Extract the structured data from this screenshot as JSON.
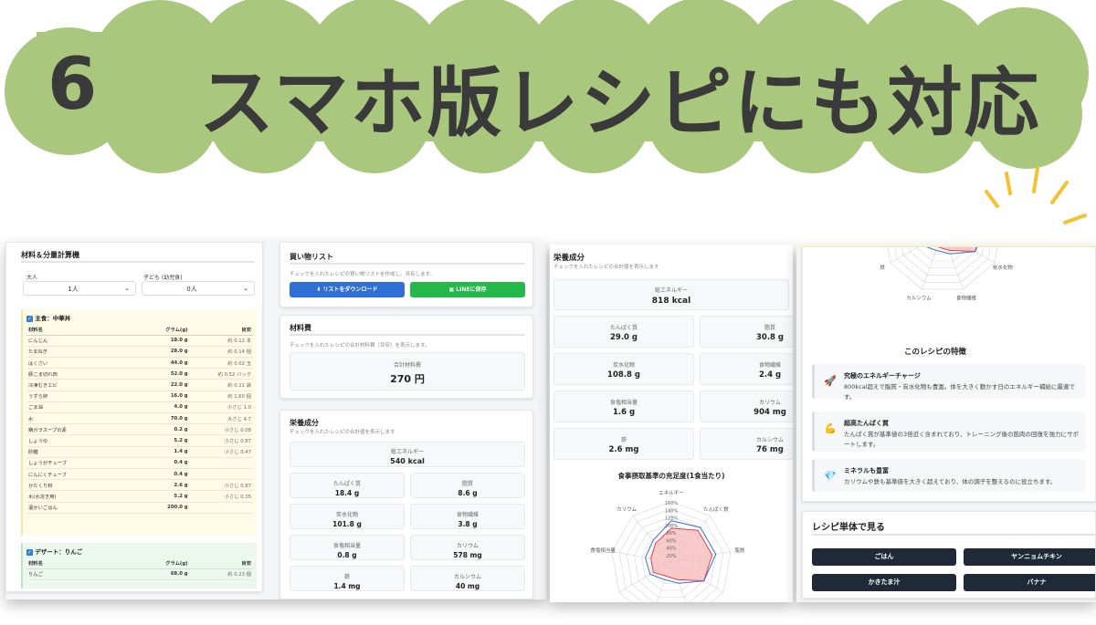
{
  "banner": {
    "number": "6",
    "title": "スマホ版レシピにも対応"
  },
  "calculator": {
    "title": "材料＆分量計算機",
    "adults_label": "大人",
    "adults_value": "1人",
    "kids_label": "子ども (幼児食)",
    "kids_value": "0人",
    "main_section": "主食：中華丼",
    "headers": [
      "材料名",
      "グラム(g)",
      "目安"
    ],
    "main_rows": [
      [
        "にんじん",
        "18.0 g",
        "約 0.12 本"
      ],
      [
        "たまねぎ",
        "28.0 g",
        "約 0.14 個"
      ],
      [
        "はくさい",
        "44.0 g",
        "約 0.02 玉"
      ],
      [
        "豚こま切れ肉",
        "52.0 g",
        "約 0.52 パック"
      ],
      [
        "冷凍むきエビ",
        "22.0 g",
        "約 0.11 袋"
      ],
      [
        "うずら卵",
        "16.0 g",
        "約 1.60 個"
      ],
      [
        "ごま油",
        "4.0 g",
        "小さじ 1.0"
      ],
      [
        "水",
        "70.0 g",
        "大さじ 4.7"
      ],
      [
        "鶏ガラスープの素",
        "0.2 g",
        "小さじ 0.08"
      ],
      [
        "しょうゆ",
        "5.2 g",
        "小さじ 0.87"
      ],
      [
        "砂糖",
        "1.4 g",
        "小さじ 0.47"
      ],
      [
        "しょうがチューブ",
        "0.4 g",
        ""
      ],
      [
        "にんにくチューブ",
        "0.4 g",
        ""
      ],
      [
        "かたくり粉",
        "2.6 g",
        "小さじ 0.87"
      ],
      [
        "水(水溶き用)",
        "5.2 g",
        "小さじ 0.35"
      ],
      [
        "温かいごはん",
        "200.0 g",
        ""
      ]
    ],
    "dessert_section": "デザート：りんご",
    "dessert_rows": [
      [
        "りんご",
        "68.0 g",
        "約 0.23 個"
      ]
    ]
  },
  "shopping": {
    "title": "買い物リスト",
    "desc": "チェックを入れたレシピの買い物リストを作成し、共有します。",
    "download_label": "リストをダウンロード",
    "line_label": "LINEに保存"
  },
  "cost": {
    "title": "材料費",
    "desc": "チェックを入れたレシピの合計材料費（目安）を表示します。",
    "total_label": "合計材料費",
    "total_value": "270 円"
  },
  "nutrition_small": {
    "title": "栄養成分",
    "desc": "チェックを入れたレシピの合計値を表示します",
    "energy_label": "総エネルギー",
    "energy_value": "540 kcal",
    "items": [
      [
        "たんぱく質",
        "18.4 g"
      ],
      [
        "脂質",
        "8.6 g"
      ],
      [
        "炭水化物",
        "101.8 g"
      ],
      [
        "食物繊維",
        "3.8 g"
      ],
      [
        "食塩相当量",
        "0.8 g"
      ],
      [
        "カリウム",
        "578 mg"
      ],
      [
        "鉄",
        "1.4 mg"
      ],
      [
        "カルシウム",
        "40 mg"
      ]
    ]
  },
  "nutrition_large": {
    "title": "栄養成分",
    "desc": "チェックを入れたレシピの合計値を表示します",
    "energy_label": "総エネルギー",
    "energy_value": "818 kcal",
    "items": [
      [
        "たんぱく質",
        "29.0 g"
      ],
      [
        "脂質",
        "30.8 g"
      ],
      [
        "炭水化物",
        "108.8 g"
      ],
      [
        "食物繊維",
        "2.4 g"
      ],
      [
        "食塩相当量",
        "1.6 g"
      ],
      [
        "カリウム",
        "904 mg"
      ],
      [
        "鉄",
        "2.6 mg"
      ],
      [
        "カルシウム",
        "76 mg"
      ]
    ],
    "chart_title": "食事摂取基準の充足度(1食当たり)"
  },
  "chart_data": {
    "type": "radar",
    "axes": [
      "エネルギー",
      "たんぱく質",
      "脂質",
      "炭水化物",
      "食物繊維",
      "カルシウム",
      "鉄",
      "食塩相当量",
      "カリウム"
    ],
    "axes_visible_lower": [
      "エネルギー",
      "たんぱく質",
      "脂質",
      "食塩相当量",
      "カリウム"
    ],
    "axes_visible_upper": [
      "鉄",
      "炭水化物",
      "カルシウム",
      "食物繊維"
    ],
    "ticks": [
      "20%",
      "40%",
      "60%",
      "80%",
      "100%",
      "120%",
      "140%",
      "160%"
    ],
    "rmax": 160,
    "series": [
      {
        "values": [
          90,
          110,
          110,
          100,
          50,
          40,
          55,
          55,
          65
        ]
      },
      {
        "values": [
          110,
          120,
          120,
          100,
          60,
          50,
          65,
          70,
          75
        ]
      }
    ],
    "colors": {
      "fill": "#f7b8b8",
      "line_red": "#e0434b",
      "line_blue": "#3b6fd6"
    }
  },
  "features": {
    "title": "このレシピの特徴",
    "items": [
      {
        "icon": "🚀",
        "title": "究極のエネルギーチャージ",
        "desc": "800kcal超えで脂質・炭水化物も豊富。体を大きく動かす日のエネルギー補給に最適です。"
      },
      {
        "icon": "💪",
        "title": "超高たんぱく質",
        "desc": "たんぱく質が基準値の3倍近く含まれており、トレーニング後の筋肉の回復を強力にサポートします。"
      },
      {
        "icon": "💎",
        "title": "ミネラルも豊富",
        "desc": "カリウムや鉄も基準値を大きく超えており、体の調子を整えるのに役立ちます。"
      }
    ]
  },
  "single_recipes": {
    "title": "レシピ単体で見る",
    "buttons": [
      "ごはん",
      "ヤンニョムチキン",
      "かきたま汁",
      "バナナ"
    ]
  }
}
